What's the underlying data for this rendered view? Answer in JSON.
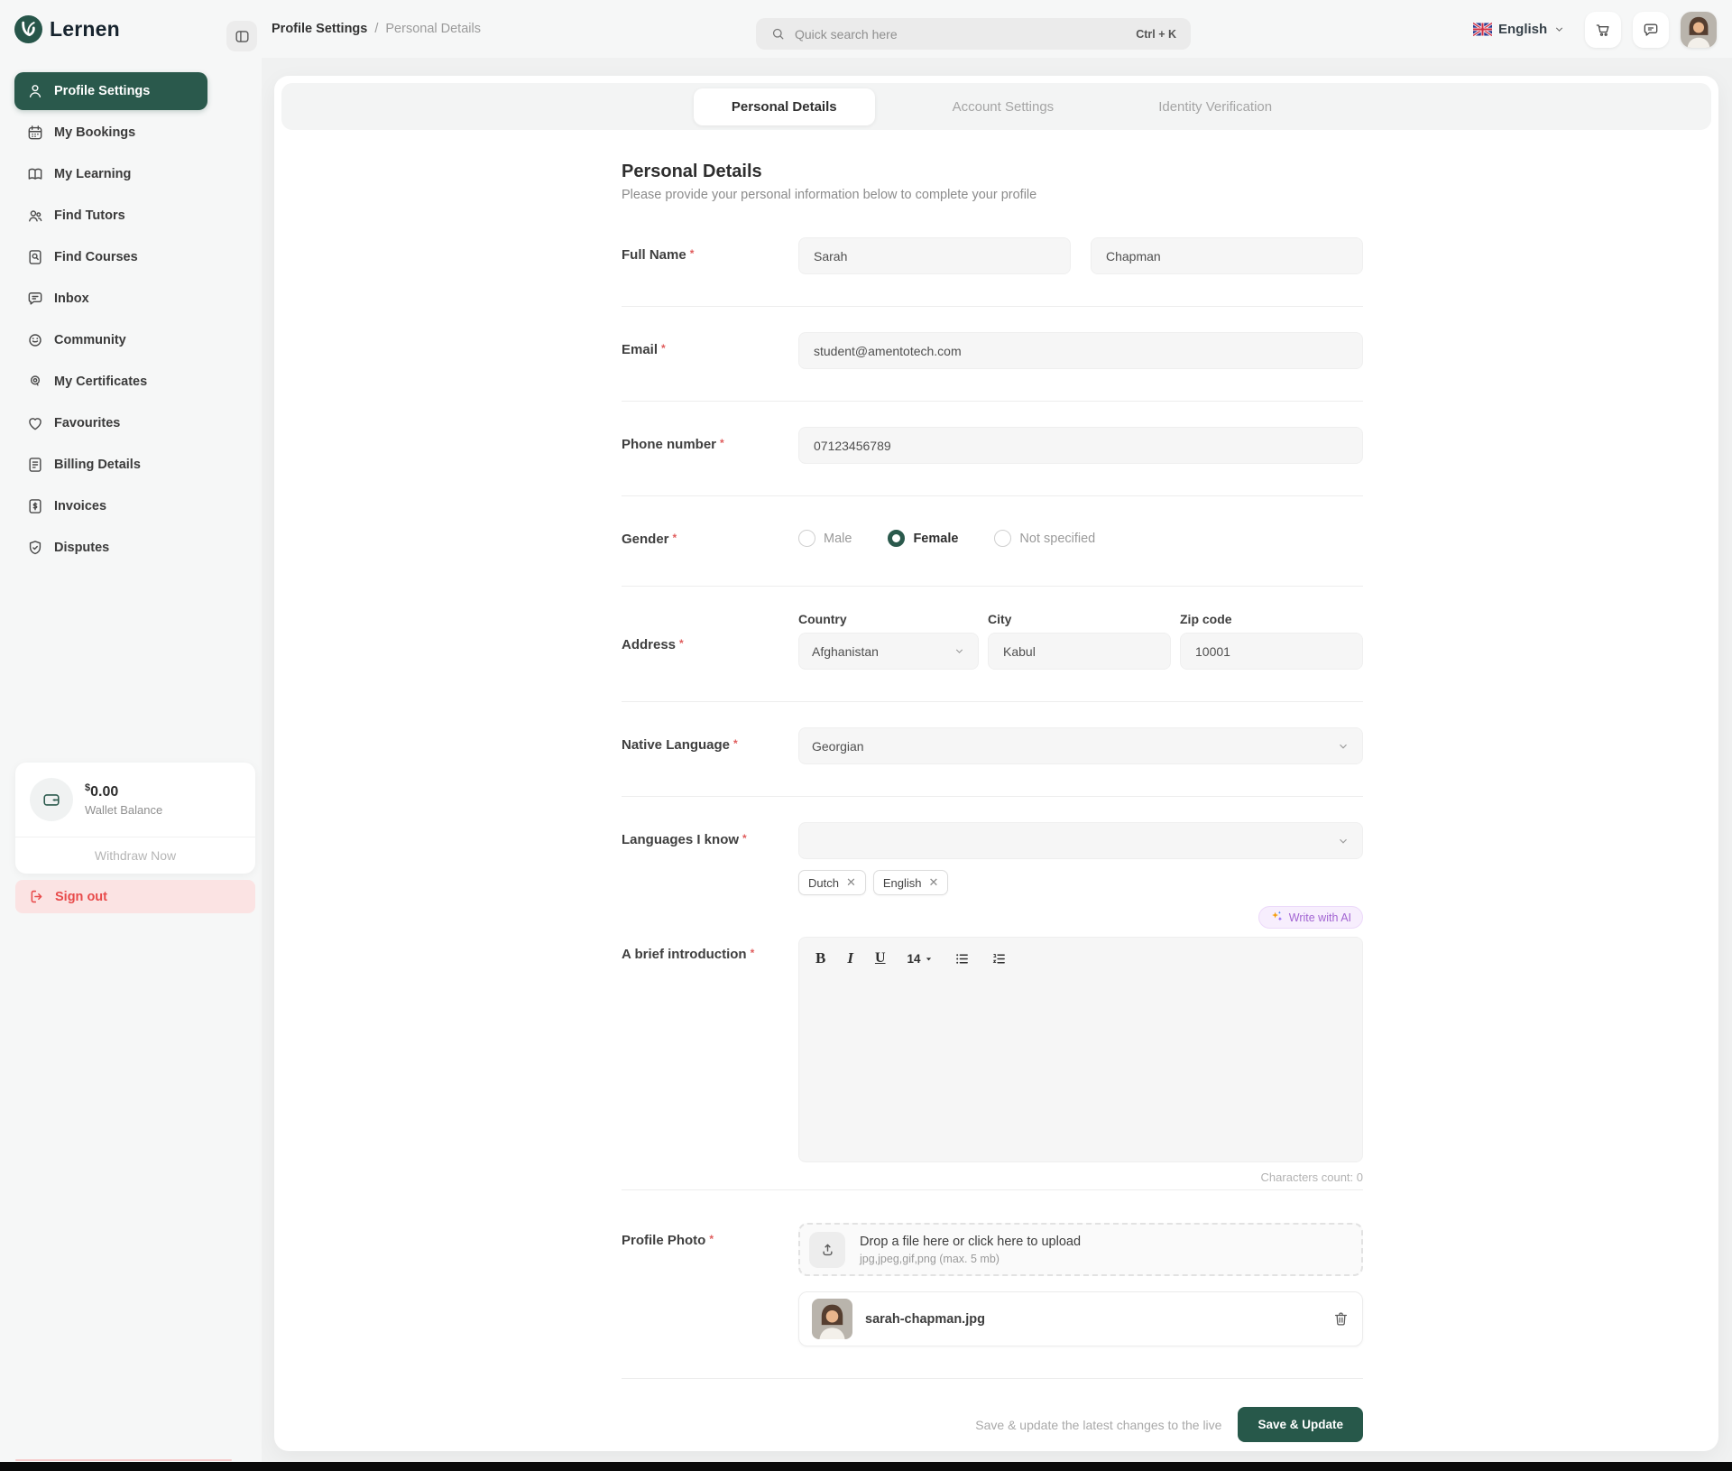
{
  "brand": {
    "name": "Lernen"
  },
  "topbar": {
    "breadcrumb": {
      "root": "Profile Settings",
      "separator": "/",
      "current": "Personal Details"
    },
    "search": {
      "placeholder": "Quick search here",
      "shortcut": "Ctrl + K"
    },
    "language": {
      "label": "English"
    }
  },
  "sidebar": {
    "items": [
      {
        "label": "Profile Settings"
      },
      {
        "label": "My Bookings"
      },
      {
        "label": "My Learning"
      },
      {
        "label": "Find Tutors"
      },
      {
        "label": "Find Courses"
      },
      {
        "label": "Inbox"
      },
      {
        "label": "Community"
      },
      {
        "label": "My Certificates"
      },
      {
        "label": "Favourites"
      },
      {
        "label": "Billing Details"
      },
      {
        "label": "Invoices"
      },
      {
        "label": "Disputes"
      }
    ],
    "wallet": {
      "currency": "$",
      "amount": "0.00",
      "label": "Wallet Balance",
      "action": "Withdraw Now"
    },
    "signout_label": "Sign out"
  },
  "tabs": [
    {
      "label": "Personal Details"
    },
    {
      "label": "Account Settings"
    },
    {
      "label": "Identity Verification"
    }
  ],
  "form": {
    "title": "Personal Details",
    "subtitle": "Please provide your personal information below to complete your profile",
    "required_marker": "*",
    "full_name": {
      "label": "Full Name",
      "first": "Sarah",
      "last": "Chapman"
    },
    "email": {
      "label": "Email",
      "value": "student@amentotech.com"
    },
    "phone": {
      "label": "Phone number",
      "value": "07123456789"
    },
    "gender": {
      "label": "Gender",
      "options": [
        {
          "label": "Male"
        },
        {
          "label": "Female"
        },
        {
          "label": "Not specified"
        }
      ],
      "selected": "Female"
    },
    "address": {
      "label": "Address",
      "country": {
        "label": "Country",
        "value": "Afghanistan"
      },
      "city": {
        "label": "City",
        "value": "Kabul"
      },
      "zip": {
        "label": "Zip code",
        "value": "10001"
      }
    },
    "native_language": {
      "label": "Native Language",
      "value": "Georgian"
    },
    "languages": {
      "label": "Languages I know",
      "chips": [
        "Dutch",
        "English"
      ]
    },
    "intro": {
      "label": "A brief introduction",
      "ai_button": "Write with AI",
      "font_size": "14",
      "characters_count": "Characters count: 0"
    },
    "photo": {
      "label": "Profile Photo",
      "drop_title": "Drop a file here or click here to upload",
      "drop_hint": "jpg,jpeg,gif,png (max. 5 mb)",
      "file_name": "sarah-chapman.jpg"
    },
    "footer": {
      "hint": "Save & update the latest changes to the live",
      "submit": "Save & Update"
    }
  },
  "colors": {
    "accent_green": "#2a594c",
    "signout_red": "#e84b4b",
    "ai_purple": "#a264d2"
  }
}
